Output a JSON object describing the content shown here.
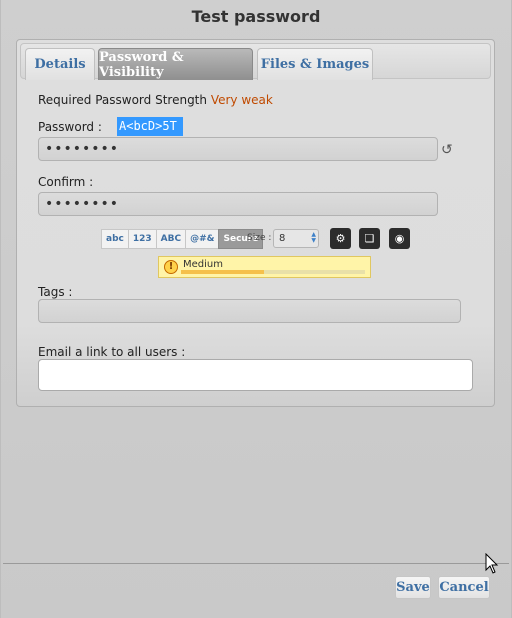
{
  "dialog": {
    "title": "Test password"
  },
  "tabs": [
    {
      "label": "Details"
    },
    {
      "label": "Password & Visibility",
      "active": true
    },
    {
      "label": "Files & Images"
    }
  ],
  "strength": {
    "label": "Required Password Strength",
    "value": "Very weak"
  },
  "password": {
    "label": "Password :",
    "plain": "A<bcD>5T",
    "masked": "••••••••"
  },
  "confirm": {
    "label": "Confirm :",
    "masked": "••••••••"
  },
  "generator": {
    "options": [
      "abc",
      "123",
      "ABC",
      "@#&",
      "Secure"
    ],
    "selected": "Secure",
    "size_label": "Size :",
    "size_value": "8"
  },
  "meter": {
    "label": "Medium",
    "level_fraction": 0.45
  },
  "tags": {
    "label": "Tags :",
    "value": ""
  },
  "email": {
    "label": "Email a link to all users :",
    "value": ""
  },
  "footer": {
    "save_label": "Save",
    "cancel_label": "Cancel"
  },
  "colors": {
    "accent": "#3e6fa3",
    "warning_text": "#c04a00",
    "selection": "#3399ff"
  }
}
